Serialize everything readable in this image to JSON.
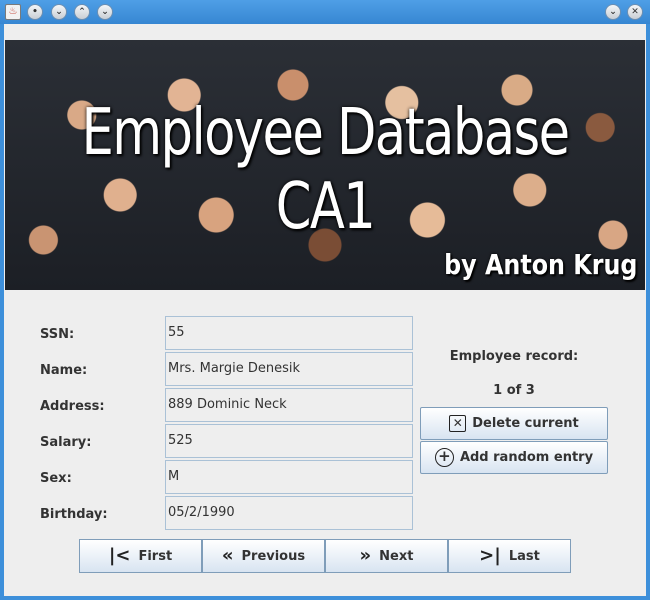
{
  "titlebar": {
    "buttons": [
      "•",
      "⌄",
      "⌃",
      "⌄",
      "⌄",
      "✕"
    ]
  },
  "banner": {
    "title_line1": "Employee Database",
    "title_line2": "CA1",
    "byline": "by Anton Krug"
  },
  "form": {
    "ssn_label": "SSN:",
    "ssn_value": "55",
    "name_label": "Name:",
    "name_value": "Mrs. Margie Denesik",
    "address_label": "Address:",
    "address_value": "889 Dominic Neck",
    "salary_label": "Salary:",
    "salary_value": "525",
    "sex_label": "Sex:",
    "sex_value": "M",
    "birthday_label": "Birthday:",
    "birthday_value": "05/2/1990"
  },
  "record": {
    "label": "Employee record:",
    "position": "1 of 3"
  },
  "actions": {
    "delete_label": "Delete current",
    "add_label": "Add random entry"
  },
  "nav": {
    "first_label": "First",
    "previous_label": "Previous",
    "next_label": "Next",
    "last_label": "Last"
  }
}
